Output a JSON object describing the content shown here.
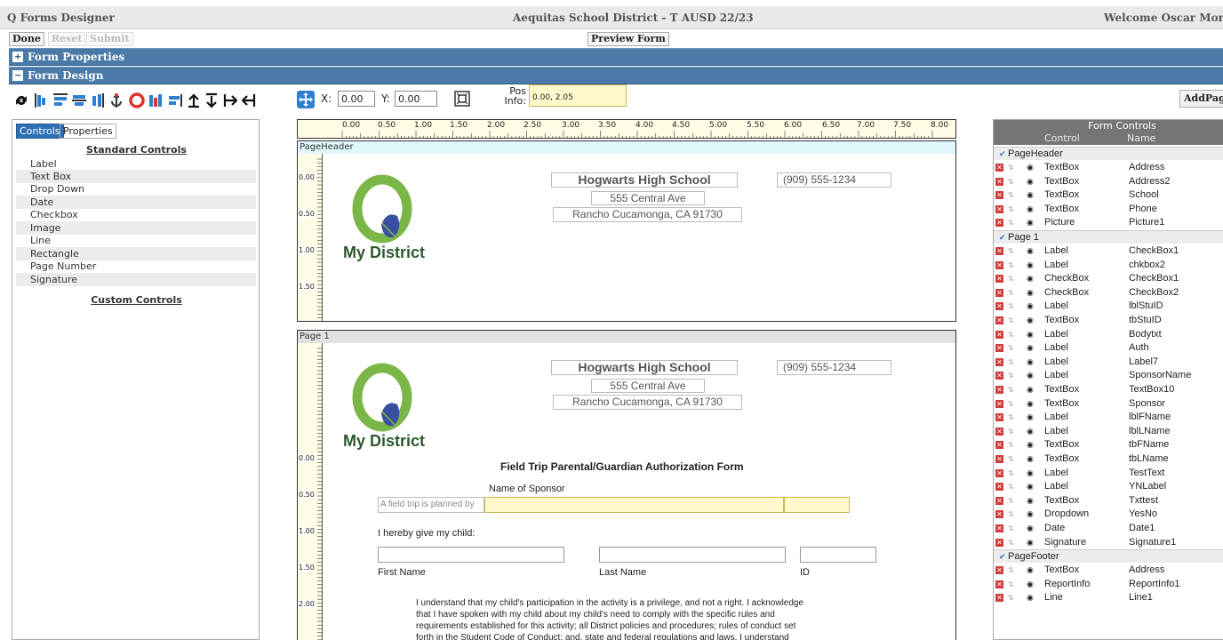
{
  "title": {
    "app": "Q Forms Designer",
    "district": "Aequitas School District - T AUSD 22/23",
    "welcome": "Welcome Oscar Morris"
  },
  "actions": {
    "done": "Done",
    "reset": "Reset",
    "submit": "Submit",
    "preview": "Preview Form"
  },
  "sections": {
    "form_properties": "Form Properties",
    "form_design": "Form Design",
    "expand": "+",
    "collapse": "−"
  },
  "toolbar": {
    "x_label": "X:",
    "x_value": "0.00",
    "y_label": "Y:",
    "y_value": "0.00",
    "pos_label_1": "Pos",
    "pos_label_2": "Info:",
    "pos_value": "0.00, 2.05",
    "add_page": "AddPag"
  },
  "left_panel": {
    "tabs": [
      "Controls",
      "Properties"
    ],
    "standard_heading": "Standard Controls",
    "standard": [
      "Label",
      "Text Box",
      "Drop Down",
      "Date",
      "Checkbox",
      "Image",
      "Line",
      "Rectangle",
      "Page Number",
      "Signature"
    ],
    "custom_heading": "Custom Controls"
  },
  "ruler": {
    "top": [
      "0.00",
      "0.50",
      "1.00",
      "1.50",
      "2.00",
      "2.50",
      "3.00",
      "3.50",
      "4.00",
      "4.50",
      "5.00",
      "5.50",
      "6.00",
      "6.50",
      "7.00",
      "7.50",
      "8.00"
    ],
    "header_side": [
      "0.00",
      "0.50",
      "1.00",
      "1.50"
    ],
    "page_side": [
      "0.00",
      "0.50",
      "1.00",
      "1.50",
      "2.00"
    ]
  },
  "page_header": {
    "band": "PageHeader",
    "school": "Hogwarts High School",
    "address": "555 Central Ave",
    "city": "Rancho Cucamonga, CA 91730",
    "phone": "(909) 555-1234",
    "logo_text": "My District"
  },
  "page1": {
    "band": "Page 1",
    "school": "Hogwarts High School",
    "address": "555 Central Ave",
    "city": "Rancho Cucamonga, CA 91730",
    "phone": "(909) 555-1234",
    "logo_text": "My District",
    "form_title": "Field Trip Parental/Guardian Authorization Form",
    "sponsor_label": "Name of Sponsor",
    "trip_text": "A field trip is planned by",
    "give_child": "I hereby give my child:",
    "first_name": "First Name",
    "last_name": "Last Name",
    "id": "ID",
    "body": [
      "I understand that my child's participation in the activity is a privilege, and not a right. I acknowledge",
      "that I have spoken with my child about my child's need to comply with the specific rules and",
      "requirements established for this activity; all District policies and procedures; rules of conduct set",
      "forth in the Student Code of Conduct; and, state and federal regulations and laws. I understand"
    ]
  },
  "right_panel": {
    "title": "Form Controls",
    "col_control": "Control",
    "col_name": "Name",
    "groups": [
      {
        "name": "PageHeader",
        "rows": [
          [
            "TextBox",
            "Address"
          ],
          [
            "TextBox",
            "Address2"
          ],
          [
            "TextBox",
            "School"
          ],
          [
            "TextBox",
            "Phone"
          ],
          [
            "Picture",
            "Picture1"
          ]
        ]
      },
      {
        "name": "Page 1",
        "rows": [
          [
            "Label",
            "CheckBox1"
          ],
          [
            "Label",
            "chkbox2"
          ],
          [
            "CheckBox",
            "CheckBox1"
          ],
          [
            "CheckBox",
            "CheckBox2"
          ],
          [
            "Label",
            "lblStuID"
          ],
          [
            "TextBox",
            "tbStuID"
          ],
          [
            "Label",
            "Bodytxt"
          ],
          [
            "Label",
            "Auth"
          ],
          [
            "Label",
            "Label7"
          ],
          [
            "Label",
            "SponsorName"
          ],
          [
            "TextBox",
            "TextBox10"
          ],
          [
            "TextBox",
            "Sponsor"
          ],
          [
            "Label",
            "lblFName"
          ],
          [
            "Label",
            "lblLName"
          ],
          [
            "TextBox",
            "tbFName"
          ],
          [
            "TextBox",
            "tbLName"
          ],
          [
            "Label",
            "TestText"
          ],
          [
            "Label",
            "YNLabel"
          ],
          [
            "TextBox",
            "Txttest"
          ],
          [
            "Dropdown",
            "YesNo"
          ],
          [
            "Date",
            "Date1"
          ],
          [
            "Signature",
            "Signature1"
          ]
        ]
      },
      {
        "name": "PageFooter",
        "rows": [
          [
            "TextBox",
            "Address"
          ],
          [
            "ReportInfo",
            "ReportInfo1"
          ],
          [
            "Line",
            "Line1"
          ]
        ]
      }
    ]
  },
  "colors": {
    "section_bar": "#4a7aa8",
    "logo_green": "#7ab648",
    "logo_leaf": "#3b4fa0",
    "logo_text": "#2e5a2e",
    "field_yellow": "#fff9cc"
  }
}
